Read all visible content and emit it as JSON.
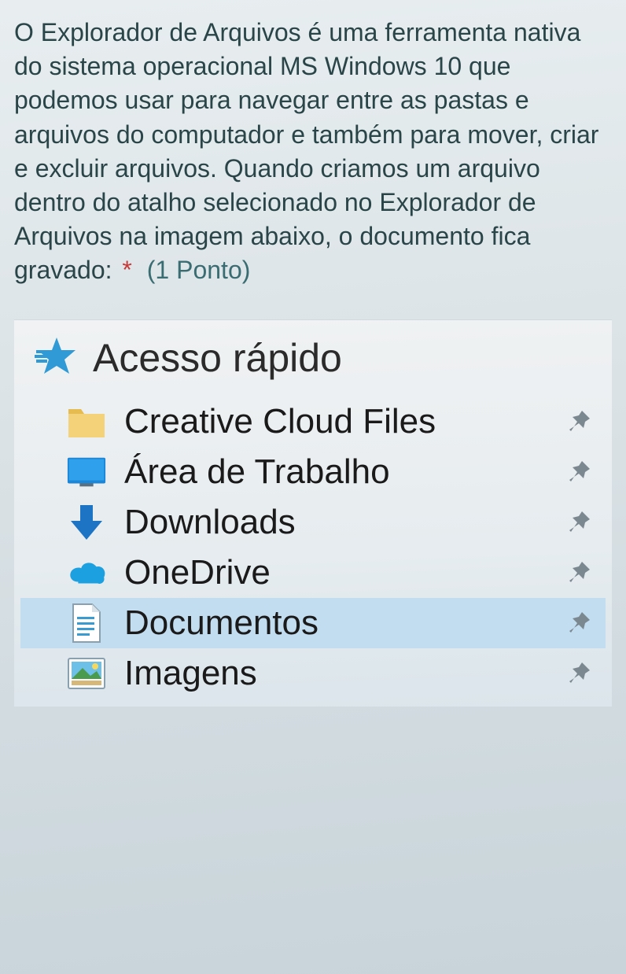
{
  "question": {
    "text": "O Explorador de Arquivos é uma ferramenta nativa do sistema operacional MS Windows 10 que podemos usar para navegar entre as pastas e arquivos do computador e também para mover, criar e excluir arquivos. Quando criamos um arquivo dentro do atalho selecionado no Explorador de Arquivos na imagem abaixo, o documento fica gravado:",
    "required_marker": "*",
    "points_label": "(1 Ponto)"
  },
  "explorer": {
    "quick_access_label": "Acesso rápido",
    "items": [
      {
        "label": "Creative Cloud Files",
        "pinned": true,
        "selected": false,
        "icon": "folder"
      },
      {
        "label": "Área de Trabalho",
        "pinned": true,
        "selected": false,
        "icon": "desktop"
      },
      {
        "label": "Downloads",
        "pinned": true,
        "selected": false,
        "icon": "downloads"
      },
      {
        "label": "OneDrive",
        "pinned": true,
        "selected": false,
        "icon": "onedrive"
      },
      {
        "label": "Documentos",
        "pinned": true,
        "selected": true,
        "icon": "documents"
      },
      {
        "label": "Imagens",
        "pinned": true,
        "selected": false,
        "icon": "images"
      }
    ]
  }
}
